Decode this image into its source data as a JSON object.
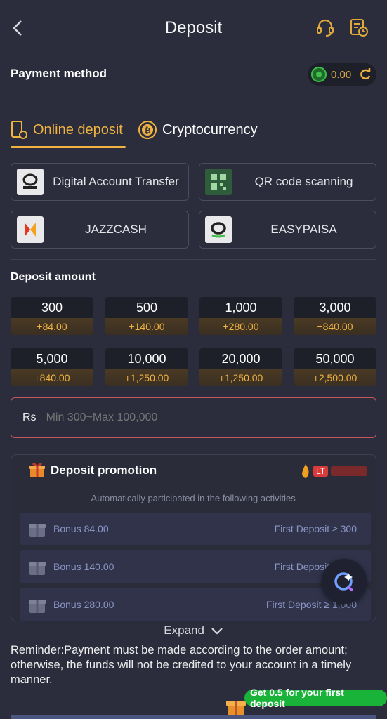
{
  "header": {
    "title": "Deposit",
    "back_icon": "chevron-left-icon",
    "support_icon": "headset-icon",
    "history_icon": "history-icon"
  },
  "payment": {
    "label": "Payment method",
    "balance": "0.00"
  },
  "tabs": [
    {
      "label": "Online deposit",
      "icon": "phone-icon",
      "active": true
    },
    {
      "label": "Cryptocurrency",
      "icon": "bitcoin-icon",
      "active": false
    }
  ],
  "methods": [
    {
      "label": "Digital Account Transfer",
      "icon": "digital-account-logo"
    },
    {
      "label": "QR code scanning",
      "icon": "qr-logo"
    },
    {
      "label": "JAZZCASH",
      "icon": "jazzcash-logo"
    },
    {
      "label": "EASYPAISA",
      "icon": "easypaisa-logo"
    }
  ],
  "deposit_amount": {
    "label": "Deposit amount",
    "options": [
      {
        "amount": "300",
        "bonus": "+84.00"
      },
      {
        "amount": "500",
        "bonus": "+140.00"
      },
      {
        "amount": "1,000",
        "bonus": "+280.00"
      },
      {
        "amount": "3,000",
        "bonus": "+840.00"
      },
      {
        "amount": "5,000",
        "bonus": "+840.00"
      },
      {
        "amount": "10,000",
        "bonus": "+1,250.00"
      },
      {
        "amount": "20,000",
        "bonus": "+1,250.00"
      },
      {
        "amount": "50,000",
        "bonus": "+2,500.00"
      }
    ]
  },
  "input": {
    "currency": "Rs",
    "placeholder": "Min 300~Max 100,000"
  },
  "promotion": {
    "title": "Deposit promotion",
    "badge": "LT",
    "subtitle": "— Automatically participated in the following activities —",
    "bonuses": [
      {
        "name": "Bonus 84.00",
        "condition": "First Deposit ≥ 300"
      },
      {
        "name": "Bonus 140.00",
        "condition": "First Deposit ≥ 500"
      },
      {
        "name": "Bonus 280.00",
        "condition": "First Deposit ≥ 1,000"
      }
    ]
  },
  "expand_label": "Expand",
  "reminder": "Reminder:Payment must be made according to the order amount; otherwise, the funds will not be credited to your account in a timely manner.",
  "first_deposit_badge": "Get 0.5 for your first deposit",
  "colors": {
    "accent": "#f0b341",
    "background": "#2b2d3c",
    "error_border": "#c4575e",
    "badge_green": "#19b33a"
  }
}
